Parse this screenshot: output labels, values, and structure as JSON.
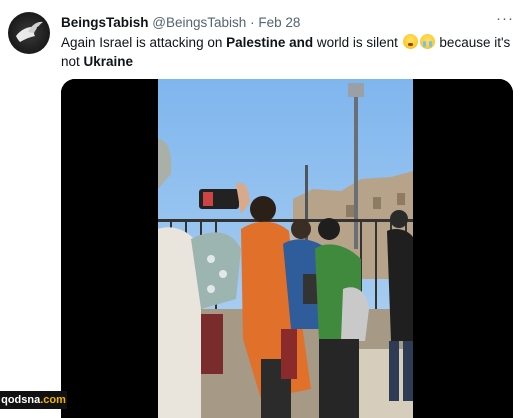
{
  "tweet": {
    "display_name": "BeingsTabish",
    "handle": "@BeingsTabish",
    "separator": "·",
    "date": "Feb 28",
    "more_label": "···",
    "text": {
      "p1": "Again Israel is attacking on ",
      "b1": "Palestine and",
      "p2": " world is silent ",
      "p3": " because it's not ",
      "b2": "Ukraine"
    },
    "emojis": [
      "hushed-face-emoji",
      "loudly-crying-face-emoji"
    ]
  },
  "media": {
    "type": "video-still",
    "icon": "video-frame"
  },
  "watermark": {
    "main": "qodsna",
    "suffix": ".com"
  },
  "colors": {
    "text": "#0f1419",
    "secondary": "#536471",
    "watermark_accent": "#f0b400"
  }
}
